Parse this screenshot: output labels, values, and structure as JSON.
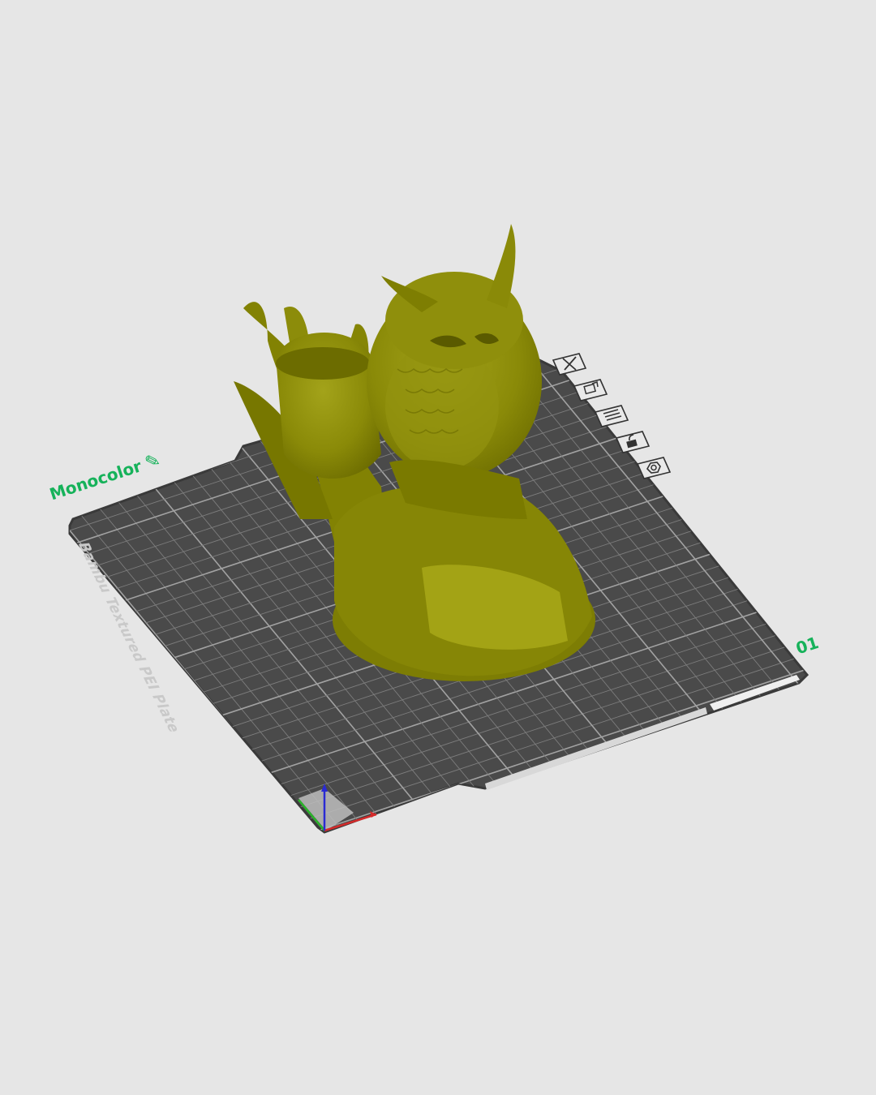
{
  "plate": {
    "name": "Monocolor",
    "number": "01",
    "bed_type": "Bambu Textured PEI Plate"
  },
  "toolbar": {
    "buttons": [
      {
        "name": "close-plate-button",
        "icon": "x-icon"
      },
      {
        "name": "arrange-button",
        "icon": "arrange-icon"
      },
      {
        "name": "plate-settings-button",
        "icon": "list-icon"
      },
      {
        "name": "lock-button",
        "icon": "unlock-icon"
      },
      {
        "name": "plate-settings-gear-button",
        "icon": "gear-icon"
      }
    ]
  },
  "colors": {
    "background": "#e6e6e6",
    "bed": "#4a4a4a",
    "bed_border": "#3a3a3a",
    "grid": "#8e8e8e",
    "model": "#8c8c0a",
    "label": "#16b25a",
    "axis_x": "#d42a2a",
    "axis_y": "#2ab52a",
    "axis_z": "#2a2ad4"
  }
}
